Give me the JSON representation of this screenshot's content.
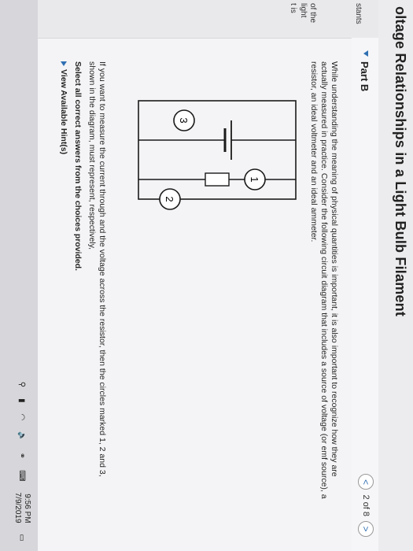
{
  "title": "oltage Relationships in a Light Bulb Filament",
  "side_fragments": [
    "stants",
    "of the",
    "light",
    "t is"
  ],
  "part_label": "Part B",
  "pager": {
    "prev": "<",
    "text": "2 of 8",
    "next": ">"
  },
  "intro": "While understanding the meaning of physical quantities is important, it is also important to recognize how they are actually measured in practice. Consider the following circuit diagram that includes a source of voltage (or emf source), a resistor, an ideal voltmeter and an ideal ammeter.",
  "circuit_labels": {
    "c1": "1",
    "c2": "2",
    "c3": "3"
  },
  "question": "If you want to measure the current through and the voltage across the resistor, then the circles marked 1, 2 and 3, shown in the diagram, must represent, respectively,",
  "instruction": "Select all correct answers from the choices provided.",
  "hints": "View Available Hint(s)",
  "taskbar": {
    "time": "9:56 PM",
    "date": "7/9/2019"
  }
}
